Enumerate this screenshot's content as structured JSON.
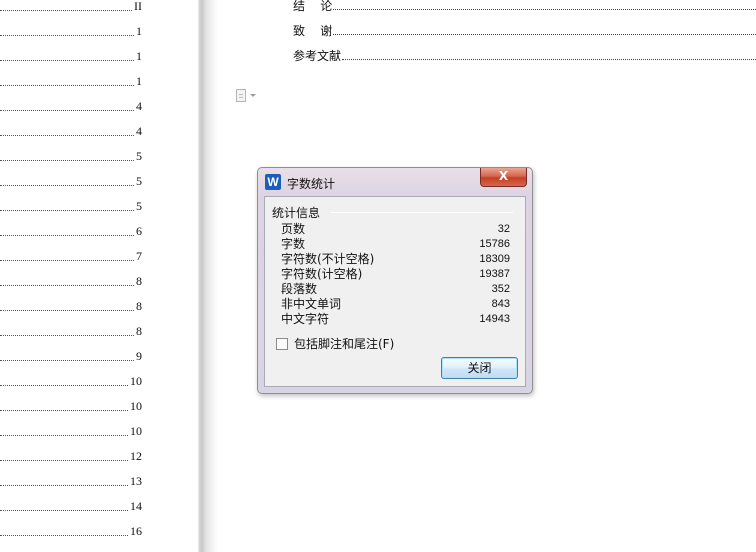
{
  "left_page": {
    "toc_numbers": [
      "II",
      "1",
      "1",
      "1",
      "4",
      "4",
      "5",
      "5",
      "5",
      "6",
      "7",
      "8",
      "8",
      "8",
      "9",
      "10",
      "10",
      "10",
      "12",
      "13",
      "14",
      "16"
    ]
  },
  "right_page": {
    "toc_entries": [
      {
        "label": "结    论"
      },
      {
        "label": "致    谢"
      },
      {
        "label": "参考文献"
      }
    ],
    "icons": {
      "doc": "document-icon",
      "caret": "chevron-down-icon"
    }
  },
  "dialog": {
    "title": "字数统计",
    "app_icon_letter": "W",
    "close_glyph": "X",
    "group_label": "统计信息",
    "stats": [
      {
        "label": "页数",
        "value": "32"
      },
      {
        "label": "字数",
        "value": "15786"
      },
      {
        "label": "字符数(不计空格)",
        "value": "18309"
      },
      {
        "label": "字符数(计空格)",
        "value": "19387"
      },
      {
        "label": "段落数",
        "value": "352"
      },
      {
        "label": "非中文单词",
        "value": "843"
      },
      {
        "label": "中文字符",
        "value": "14943"
      }
    ],
    "checkbox_label": "包括脚注和尾注(F)",
    "checkbox_checked": false,
    "close_button_label": "关闭",
    "colors": {
      "close_accent": "#c43f26",
      "button_border": "#3c7fb1",
      "app_icon": "#1d5fb8"
    }
  }
}
